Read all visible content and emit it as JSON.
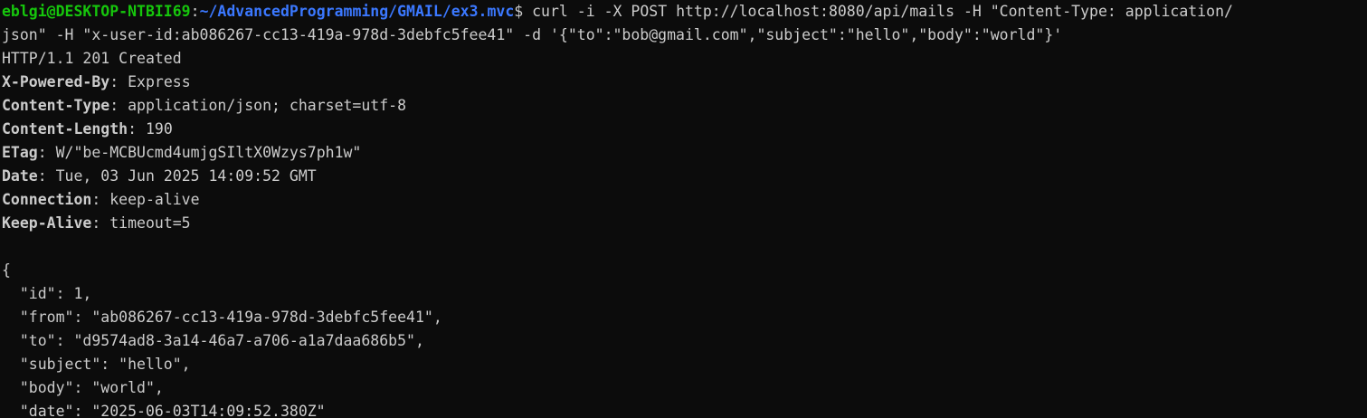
{
  "prompt": {
    "user_host": "eblgi@DESKTOP-NTBII69",
    "colon": ":",
    "path": "~/AdvancedProgramming/GMAIL/ex3.mvc",
    "dollar": "$"
  },
  "command": {
    "line1": " curl -i -X POST http://localhost:8080/api/mails -H \"Content-Type: application/",
    "line2": "json\" -H \"x-user-id:ab086267-cc13-419a-978d-3debfc5fee41\" -d '{\"to\":\"bob@gmail.com\",\"subject\":\"hello\",\"body\":\"world\"}'"
  },
  "status_line": "HTTP/1.1 201 Created",
  "headers": [
    {
      "key": "X-Powered-By",
      "value": ": Express"
    },
    {
      "key": "Content-Type",
      "value": ": application/json; charset=utf-8"
    },
    {
      "key": "Content-Length",
      "value": ": 190"
    },
    {
      "key": "ETag",
      "value": ": W/\"be-MCBUcmd4umjgSIltX0Wzys7ph1w\""
    },
    {
      "key": "Date",
      "value": ": Tue, 03 Jun 2025 14:09:52 GMT"
    },
    {
      "key": "Connection",
      "value": ": keep-alive"
    },
    {
      "key": "Keep-Alive",
      "value": ": timeout=5"
    }
  ],
  "body_lines": [
    "{",
    "  \"id\": 1,",
    "  \"from\": \"ab086267-cc13-419a-978d-3debfc5fee41\",",
    "  \"to\": \"d9574ad8-3a14-46a7-a706-a1a7daa686b5\",",
    "  \"subject\": \"hello\",",
    "  \"body\": \"world\",",
    "  \"date\": \"2025-06-03T14:09:52.380Z\""
  ],
  "colors": {
    "background": "#0c0c0c",
    "text": "#cccccc",
    "prompt_user": "#16c60c",
    "prompt_path": "#3b78ff"
  }
}
